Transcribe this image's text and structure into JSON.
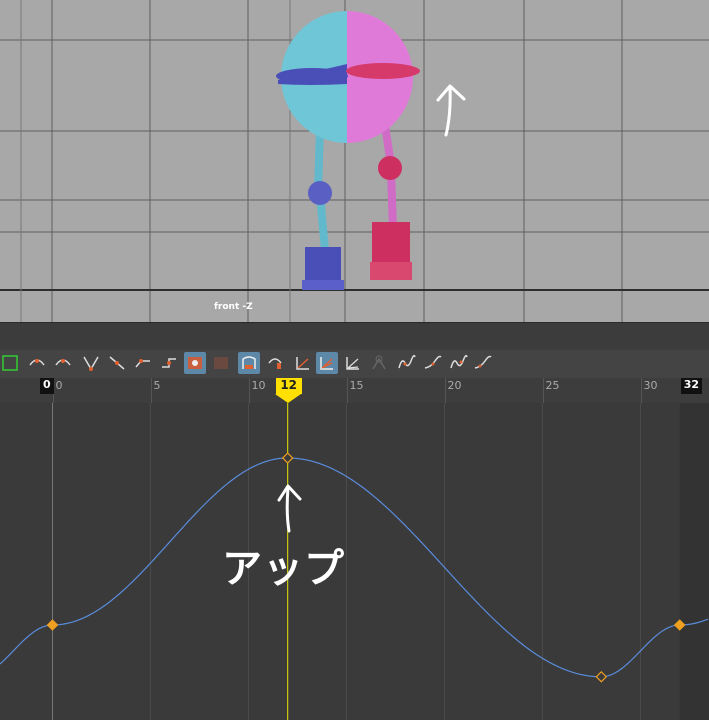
{
  "viewport": {
    "camera_label": "front -Z",
    "background_color": "#a8a8a8",
    "grid_color": "#5a5a5a"
  },
  "character": {
    "left_color": "#6fc6d6",
    "right_color": "#e07ad8",
    "band_left_color": "#4a4fb8",
    "band_right_color": "#d63a6a"
  },
  "annotations": {
    "viewport_arrow": "up-arrow-icon",
    "graph_text": "アップ"
  },
  "toolbar": {
    "icons": [
      "tangent-auto-icon",
      "tangent-spline-icon",
      "tangent-clamped-icon",
      "tangent-linear-icon",
      "tangent-flat-icon",
      "tangent-step-icon",
      "key-stats-icon",
      "buffer-curve-icon",
      "break-tangents-icon",
      "unify-tangents-icon",
      "lock-weights-icon",
      "weighted-tangents-icon",
      "normalize-icon",
      "denormalize-icon",
      "infinity-icon",
      "pre-infinity-cycle-icon",
      "post-infinity-cycle-icon",
      "curve-display-icon"
    ]
  },
  "timeline": {
    "ticks": [
      "0",
      "5",
      "10",
      "15",
      "20",
      "25",
      "30"
    ],
    "range_start": "0",
    "range_end": "32",
    "current_frame": "12"
  },
  "chart_data": {
    "type": "line",
    "title": "",
    "xlabel": "",
    "ylabel": "",
    "xlim": [
      -13.3,
      33.1
    ],
    "ylim": [
      -1.25,
      1.55
    ],
    "series": [
      {
        "values": [
          [
            0,
            0
          ],
          [
            12,
            1
          ],
          [
            28,
            -0.31
          ],
          [
            32,
            0
          ]
        ],
        "color": "#5a8cdc"
      }
    ],
    "key_color": "#f0a020",
    "current_frame_line_color": "#e6e600"
  }
}
